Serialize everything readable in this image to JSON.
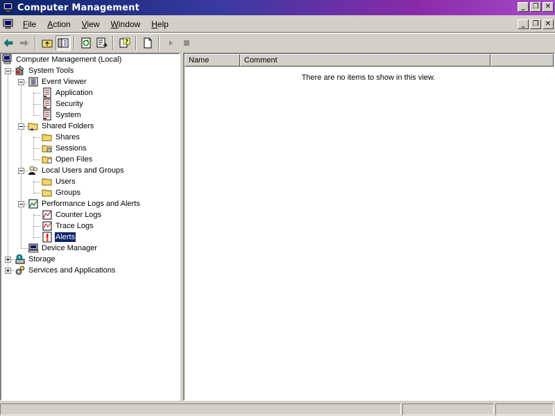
{
  "window": {
    "title": "Computer Management"
  },
  "menu": [
    {
      "label": "File",
      "ul": "F",
      "rest": "ile"
    },
    {
      "label": "Action",
      "ul": "A",
      "rest": "ction"
    },
    {
      "label": "View",
      "ul": "V",
      "rest": "iew"
    },
    {
      "label": "Window",
      "ul": "W",
      "rest": "indow"
    },
    {
      "label": "Help",
      "ul": "H",
      "rest": "elp"
    }
  ],
  "tree": {
    "root": "Computer Management (Local)",
    "system_tools": "System Tools",
    "event_viewer": "Event Viewer",
    "application": "Application",
    "security": "Security",
    "system": "System",
    "shared_folders": "Shared Folders",
    "shares": "Shares",
    "sessions": "Sessions",
    "open_files": "Open Files",
    "local_users": "Local Users and Groups",
    "users": "Users",
    "groups": "Groups",
    "perf_logs": "Performance Logs and Alerts",
    "counter_logs": "Counter Logs",
    "trace_logs": "Trace Logs",
    "alerts": "Alerts",
    "device_manager": "Device Manager",
    "storage": "Storage",
    "services": "Services and Applications",
    "selected": "Alerts"
  },
  "list": {
    "columns": [
      "Name",
      "Comment"
    ],
    "empty_message": "There are no items to show in this view."
  },
  "icons": {
    "back": "back-arrow-icon",
    "forward": "forward-arrow-icon",
    "up": "up-folder-icon",
    "show_tree": "show-hide-tree-icon",
    "refresh": "refresh-icon",
    "export": "export-list-icon",
    "help": "help-icon",
    "new": "new-document-icon",
    "play": "start-icon",
    "stop": "stop-icon"
  },
  "colors": {
    "title_gradient_start": "#0a246a",
    "title_gradient_end": "#a64ac9",
    "selection": "#0a246a",
    "face": "#d4d0c8"
  }
}
